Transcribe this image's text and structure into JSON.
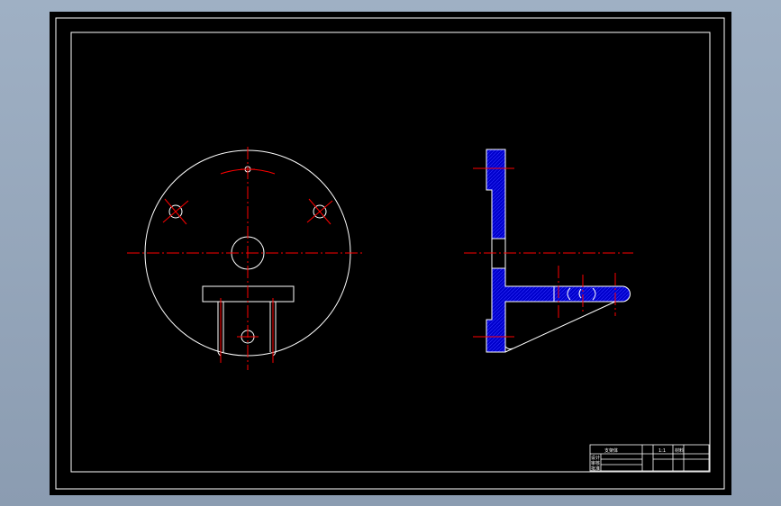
{
  "viewport": {
    "name": "model-space"
  },
  "drawing": {
    "background": "#000000",
    "line_color": "#ffffff",
    "centerline_color": "#ff0000",
    "hatch_color": "#0000cc",
    "views": [
      "front-view",
      "side-section-view"
    ]
  },
  "title_block": {
    "title": "支架体",
    "scale": "1:1",
    "sheet": "材料",
    "rows": [
      "设计",
      "审核",
      "批准"
    ]
  }
}
